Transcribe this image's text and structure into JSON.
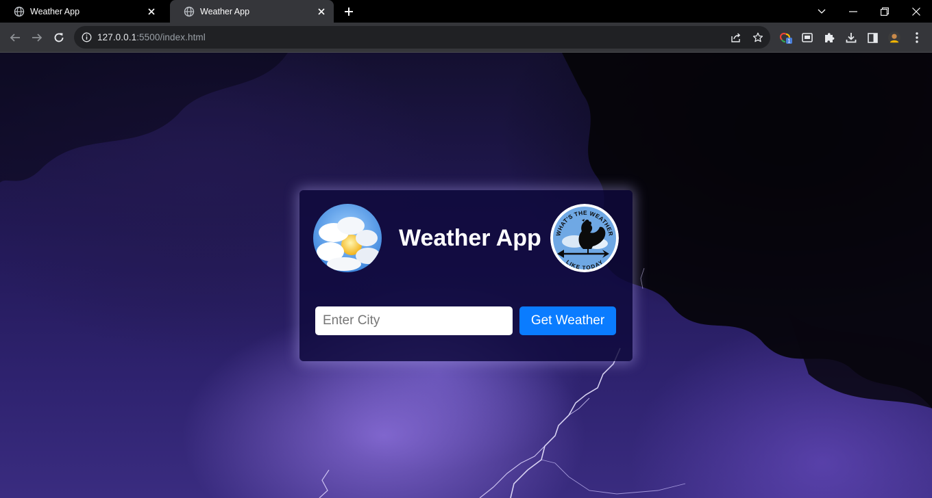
{
  "browser": {
    "tabs": [
      {
        "title": "Weather App",
        "active": false
      },
      {
        "title": "Weather App",
        "active": true
      }
    ],
    "url_host": "127.0.0.1",
    "url_rest": ":5500/index.html",
    "extension_badge": "1"
  },
  "page": {
    "title": "Weather App",
    "city_placeholder": "Enter City",
    "button_label": "Get Weather",
    "rooster_logo_text_top": "WHAT'S THE WEATHER",
    "rooster_logo_text_bottom": "LIKE TODAY"
  },
  "colors": {
    "button": "#0a7cff",
    "card_background": "rgba(15,10,60,0.82)"
  }
}
